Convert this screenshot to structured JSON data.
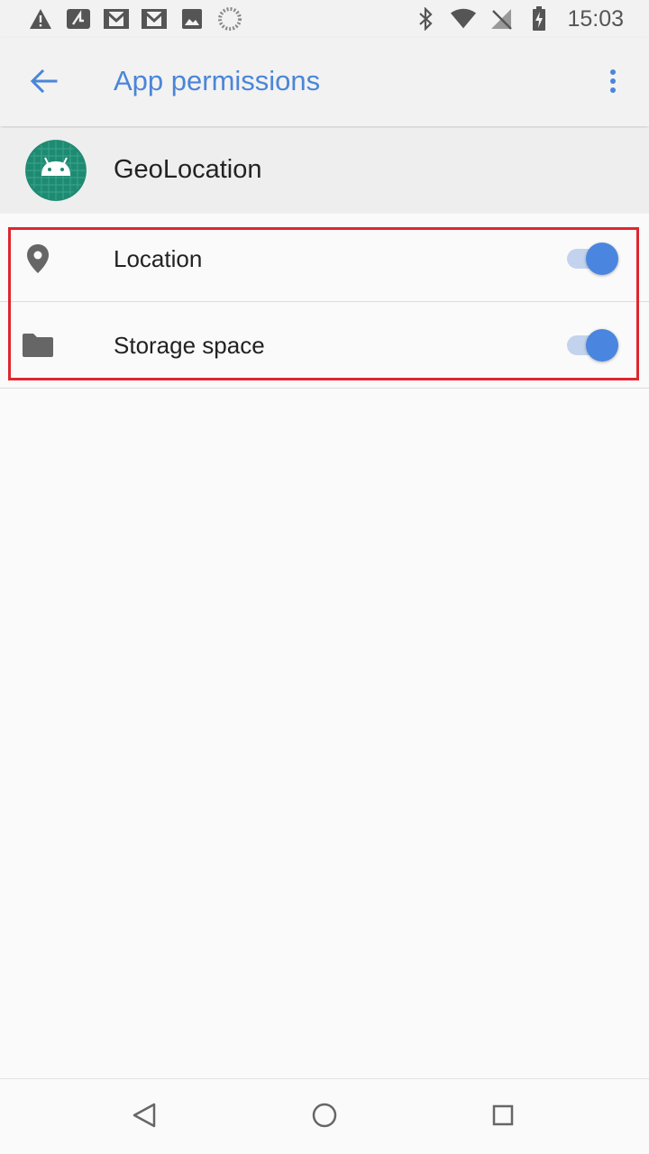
{
  "status_bar": {
    "time": "15:03",
    "left_icons": [
      "warning-icon",
      "sim-alert-icon",
      "gmail-icon",
      "gmail-icon",
      "image-icon",
      "loading-icon"
    ],
    "right_icons": [
      "bluetooth-icon",
      "wifi-icon",
      "no-signal-icon",
      "battery-charging-icon"
    ]
  },
  "app_bar": {
    "title": "App permissions",
    "back_icon": "arrow-back-icon",
    "menu_icon": "more-vert-icon"
  },
  "app": {
    "name": "GeoLocation",
    "icon": "android-icon"
  },
  "permissions": [
    {
      "label": "Location",
      "icon": "location-pin-icon",
      "enabled": true
    },
    {
      "label": "Storage space",
      "icon": "folder-icon",
      "enabled": true
    }
  ],
  "nav_bar": {
    "back_icon": "nav-back-icon",
    "home_icon": "nav-home-icon",
    "recents_icon": "nav-recents-icon"
  },
  "colors": {
    "accent": "#4a86d8",
    "toggle_thumb": "#4a86e0",
    "toggle_track": "#c3d3ee",
    "highlight": "#e0262e",
    "app_icon_bg": "#1e8a72"
  }
}
